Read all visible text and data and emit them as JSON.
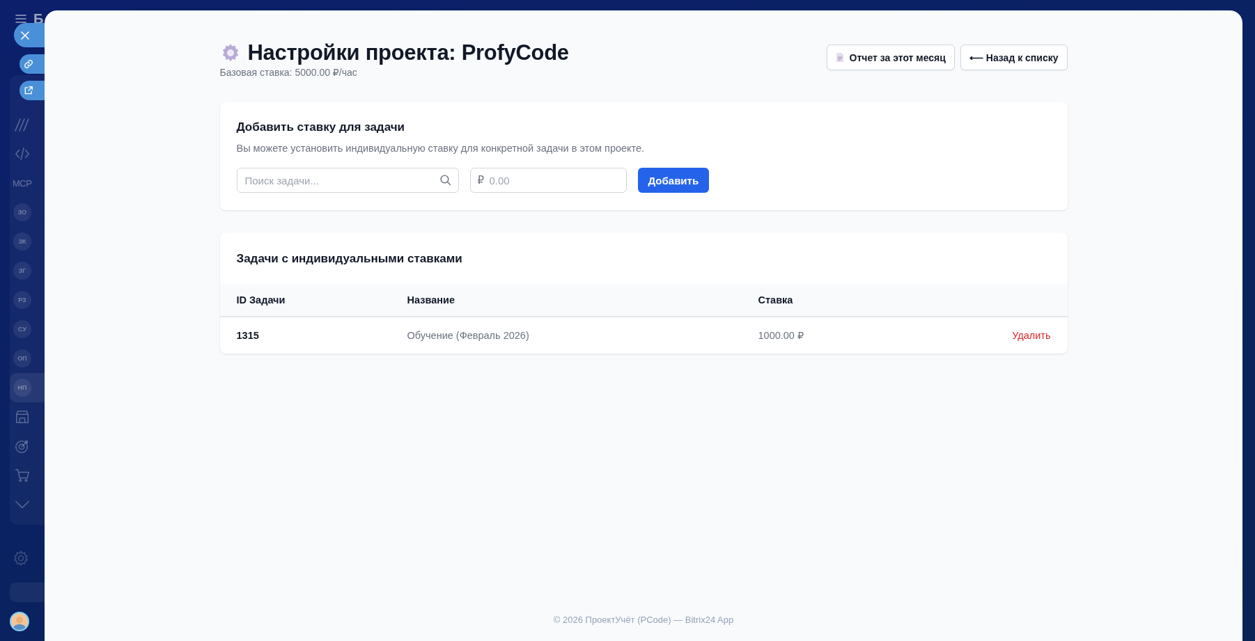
{
  "sidebar": {
    "brand_letter": "Б",
    "items": [
      {
        "kind": "brush",
        "selected": false
      },
      {
        "kind": "code",
        "selected": false
      },
      {
        "kind": "mcp",
        "badge": "MCP",
        "selected": false
      },
      {
        "kind": "badge",
        "badge": "ЗО",
        "selected": false
      },
      {
        "kind": "badge",
        "badge": "ЗК",
        "selected": false
      },
      {
        "kind": "badge",
        "badge": "ЗГ",
        "selected": false
      },
      {
        "kind": "badge",
        "badge": "РЗ",
        "selected": false
      },
      {
        "kind": "badge",
        "badge": "СУ",
        "selected": false
      },
      {
        "kind": "badge",
        "badge": "ОП",
        "selected": false
      },
      {
        "kind": "badge",
        "badge": "НП",
        "selected": true
      },
      {
        "kind": "store",
        "selected": false
      },
      {
        "kind": "target",
        "selected": false
      },
      {
        "kind": "cart",
        "selected": false
      },
      {
        "kind": "chevron",
        "selected": false
      }
    ]
  },
  "page": {
    "title": "Настройки проекта: ProfyCode",
    "subtitle": "Базовая ставка: 5000.00 ₽/час",
    "buttons": [
      {
        "kind": "report",
        "label": "Отчет за этот месяц"
      },
      {
        "kind": "back",
        "label": "⟵ Назад к списку"
      }
    ]
  },
  "add_rate": {
    "title": "Добавить ставку для задачи",
    "description": "Вы можете установить индивидуальную ставку для конкретной задачи в этом проекте.",
    "search": {
      "placeholder": "Поиск задачи..."
    },
    "rate": {
      "prefix": "₽",
      "placeholder": "0.00"
    },
    "button": "Добавить"
  },
  "rates_table": {
    "title": "Задачи с индивидуальными ставками",
    "columns": [
      "ID Задачи",
      "Название",
      "Ставка"
    ],
    "rows": [
      {
        "id": "1315",
        "name": "Обучение (Февраль 2026)",
        "rate": "1000.00 ₽",
        "action": "Удалить"
      }
    ]
  },
  "footer": "© 2026 ПроектУчёт (PCode) — Bitrix24 App"
}
